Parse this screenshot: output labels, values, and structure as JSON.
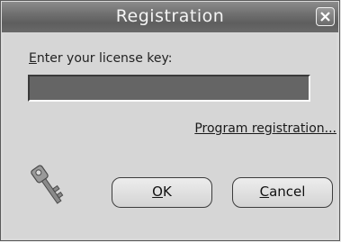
{
  "window": {
    "title": "Registration"
  },
  "form": {
    "label": "Enter your license key:",
    "license_value": "",
    "register_link": "Program registration..."
  },
  "buttons": {
    "ok": "OK",
    "cancel": "Cancel"
  },
  "icons": {
    "close": "close-icon",
    "key": "key-icon"
  }
}
